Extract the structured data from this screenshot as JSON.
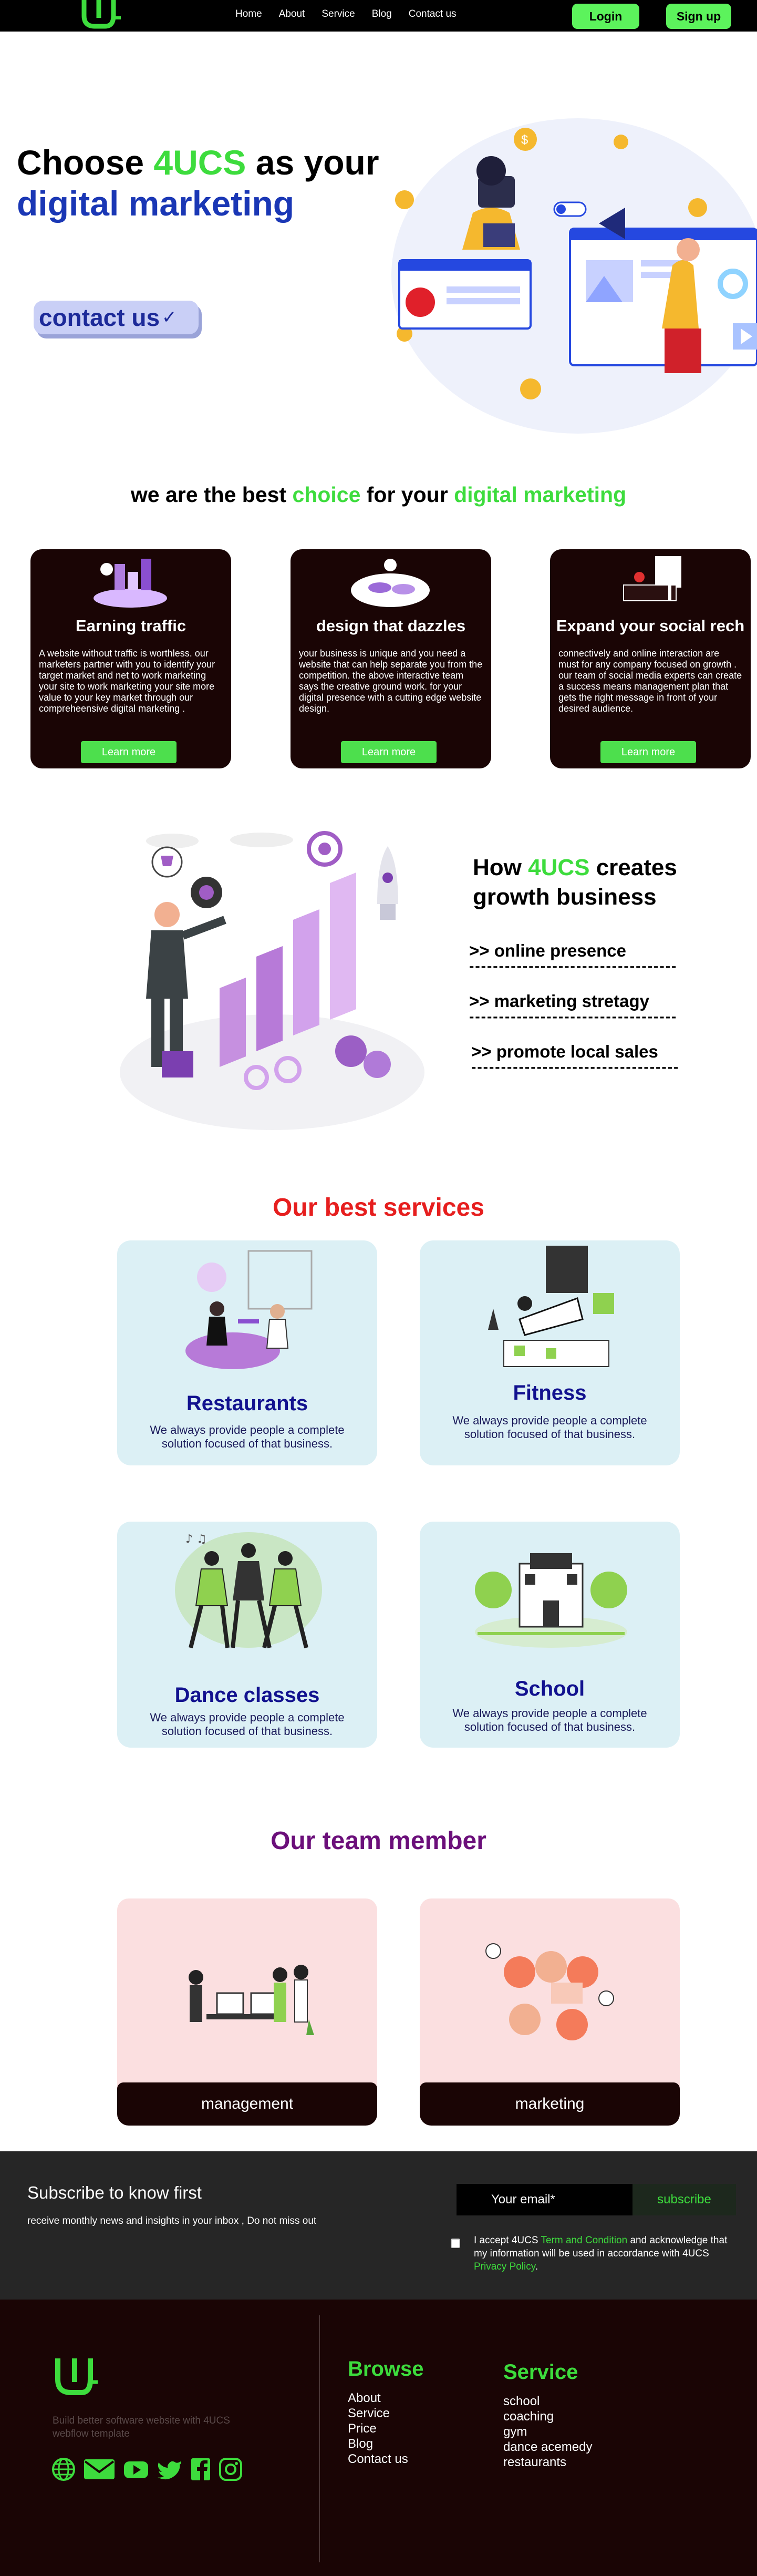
{
  "nav": {
    "links": [
      "Home",
      "About",
      "Service",
      "Blog",
      "Contact us"
    ],
    "login": "Login",
    "signup": "Sign up"
  },
  "hero": {
    "line1_a": "Choose ",
    "line1_brand": "4UCS",
    "line1_b": "  as your",
    "line2": "digital marketing",
    "contact": "contact us"
  },
  "best": {
    "title_a": "we are the best ",
    "title_b": "choice",
    "title_c": "  for your ",
    "title_d": "digital marketing",
    "cards": [
      {
        "title": "Earning traffic",
        "text": "A website without traffic is worthless. our marketers partner with you to identify your target market and net to work marketing your site to work marketing your site more value to your key market through our compreheensive digital marketing .",
        "button": "Learn more"
      },
      {
        "title": "design that dazzles",
        "text": "your business is unique and you need a website that can help separate you from the competition. the above interactive team says the creative ground work. for your digital presence with a cutting edge website design.",
        "button": "Learn more"
      },
      {
        "title": "Expand  your social rech",
        "text": "connectively and online interaction are must for any company focused on growth . our team of social media experts can create a success means management plan that gets the right message in front of your desired audience.",
        "button": "Learn more"
      }
    ]
  },
  "how": {
    "title_a": "How  ",
    "title_brand": "4UCS",
    "title_b": "  creates",
    "title_c": "growth business",
    "items": [
      ">>  online presence",
      ">>  marketing stretagy",
      ">>  promote local sales"
    ],
    "dash": "-----------------------------------"
  },
  "services": {
    "title": "Our best services",
    "items": [
      {
        "title": "Restaurants",
        "text": "We always provide people a complete solution focused of that business."
      },
      {
        "title": "Fitness",
        "text": "We always provide people a complete solution focused of that business."
      },
      {
        "title": "Dance classes",
        "text": "We always provide people a complete solution focused of that business."
      },
      {
        "title": "School",
        "text": "We always provide people a complete solution focused of that business."
      }
    ]
  },
  "team": {
    "title": "Our team member",
    "members": [
      "management",
      "marketing"
    ]
  },
  "subscribe": {
    "title": "Subscribe to know first",
    "desc": "receive monthly news and insights in your inbox , Do not miss out",
    "email_placeholder": "Your email*",
    "button": "subscribe",
    "accept_a": "I accept 4UCS ",
    "terms": "Term and Condition",
    "accept_b": " and acknowledge that my information will be used in accordance with 4UCS ",
    "privacy": "Privacy Policy",
    "accept_c": "."
  },
  "footer": {
    "tagline": "Build better software website with 4UCS webflow template",
    "browse_title": "Browse",
    "browse": [
      "About",
      "Service",
      "Price",
      "Blog",
      "Contact us"
    ],
    "service_title": "Service",
    "service": [
      "school",
      "coaching",
      "gym",
      "dance acemedy",
      "restaurants"
    ],
    "socials": [
      "globe-icon",
      "mail-icon",
      "youtube-icon",
      "twitter-icon",
      "facebook-icon",
      "instagram-icon"
    ]
  },
  "colors": {
    "brand_green": "#3ddc3d",
    "dark": "#1a0505",
    "blue": "#1a37b5",
    "red": "#e61e1e",
    "purple": "#6b0f7a"
  }
}
